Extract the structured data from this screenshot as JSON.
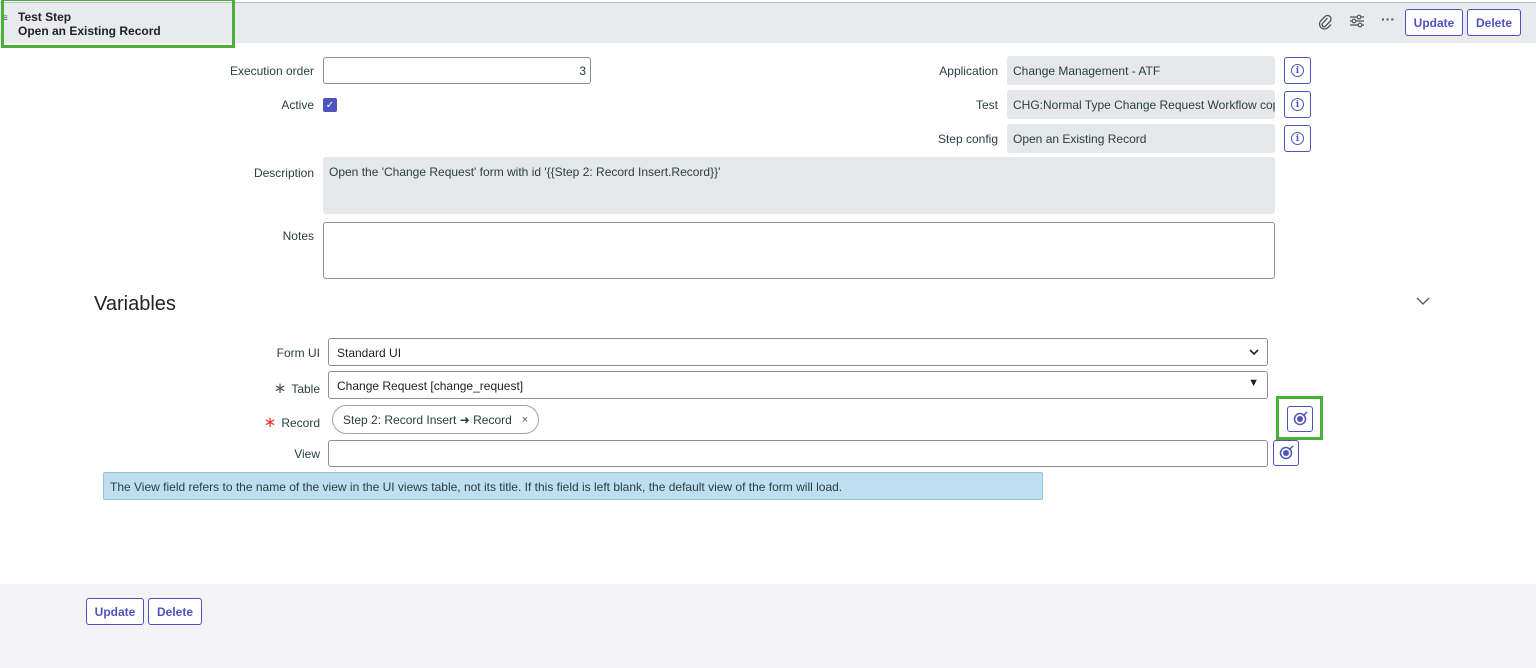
{
  "header": {
    "title_line1": "Test Step",
    "title_line2": "Open an Existing Record",
    "hamburger": "≡",
    "icons": [
      "paperclip-icon",
      "sliders-icon",
      "more-icon"
    ],
    "update_label": "Update",
    "delete_label": "Delete"
  },
  "form": {
    "execution_order": {
      "label": "Execution order",
      "value": "3"
    },
    "active": {
      "label": "Active",
      "checked": true
    },
    "description": {
      "label": "Description",
      "value": "Open the 'Change Request' form with id '{{Step 2: Record Insert.Record}}'"
    },
    "notes": {
      "label": "Notes",
      "value": ""
    },
    "application": {
      "label": "Application",
      "value": "Change Management - ATF"
    },
    "test": {
      "label": "Test",
      "value": "CHG:Normal Type Change Request Workflow copy"
    },
    "step_config": {
      "label": "Step config",
      "value": "Open an Existing Record"
    }
  },
  "variables": {
    "title": "Variables",
    "form_ui": {
      "label": "Form UI",
      "value": "Standard UI"
    },
    "table": {
      "label": "Table",
      "value": "Change Request [change_request]"
    },
    "record": {
      "label": "Record",
      "value": "Step 2: Record Insert ➜ Record",
      "remove": "×"
    },
    "view": {
      "label": "View",
      "value": ""
    },
    "help_text": "The View field refers to the name of the view in the UI views table, not its title. If this field is left blank, the default view of the form will load."
  },
  "footer": {
    "update_label": "Update",
    "delete_label": "Delete"
  },
  "colors": {
    "accent": "#4f52bd",
    "highlight": "#4caf3c",
    "help_bg": "#bfdff1",
    "required": "#e6322b"
  }
}
